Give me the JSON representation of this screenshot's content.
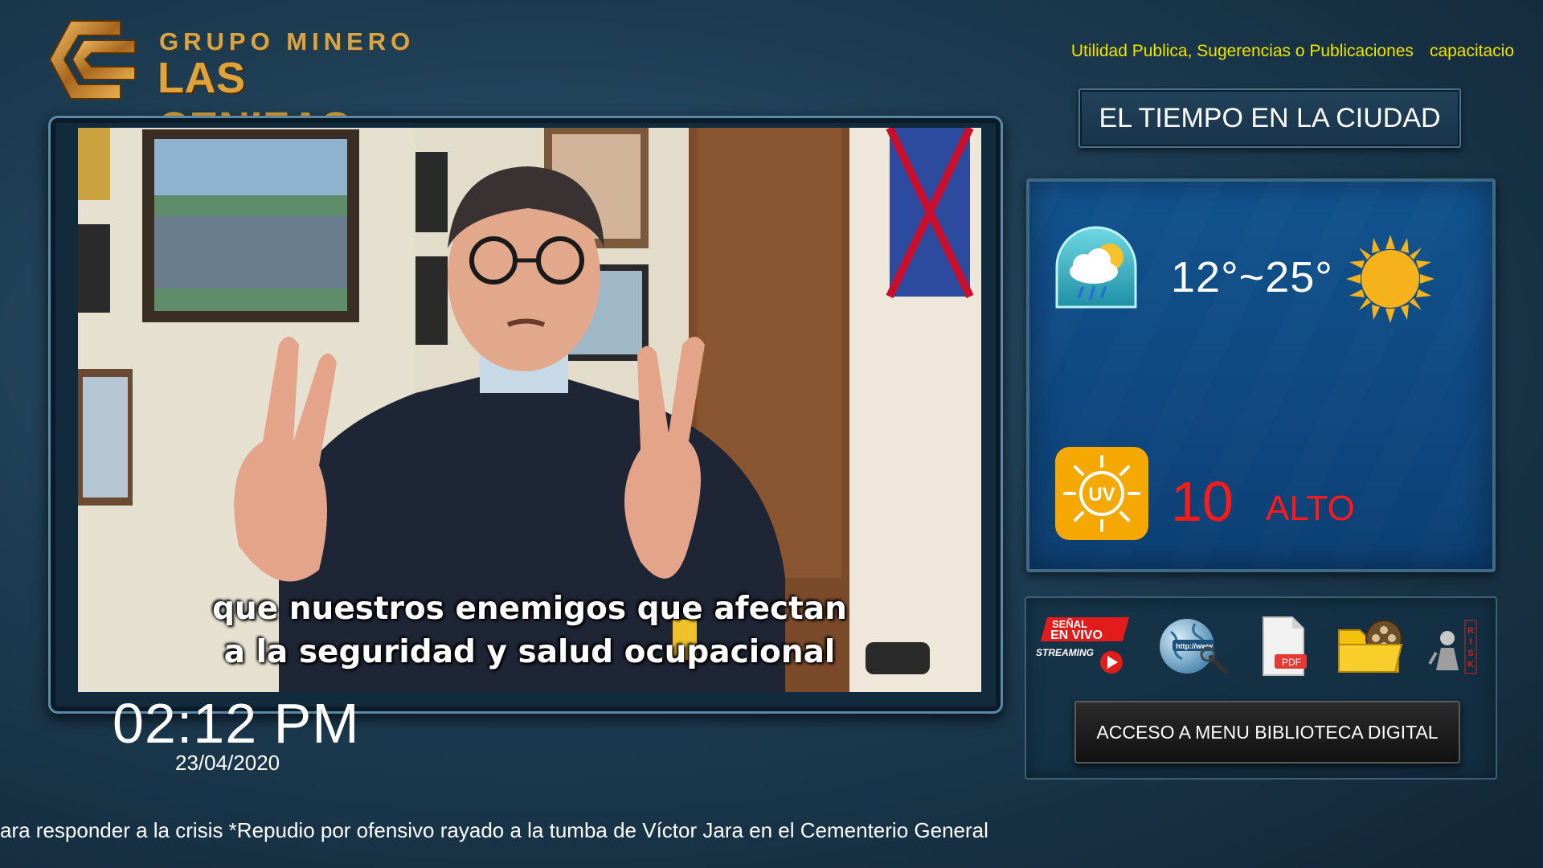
{
  "logo": {
    "line1": "GRUPO MINERO",
    "line2": "LAS CENIZAS"
  },
  "top_links": [
    {
      "label": "Utilidad Publica, Sugerencias o Publicaciones"
    },
    {
      "label": "capacitacio"
    }
  ],
  "weather": {
    "title": "EL TIEMPO EN LA CIUDAD",
    "temperature_range": "12°~25°",
    "condition_icon": "rain-cloud-sun-icon",
    "sun_icon": "sun-icon",
    "uv_badge_text": "UV",
    "uv_value": "10",
    "uv_level": "ALTO",
    "colors": {
      "uv_text": "#ff1a1a",
      "uv_badge": "#f5a800",
      "sun": "#f6b21a"
    }
  },
  "tools": {
    "items": [
      {
        "name": "live-streaming",
        "line1": "SEÑAL",
        "line2": "EN VIVO",
        "line3": "STREAMING"
      },
      {
        "name": "web-browser",
        "label": "http://www"
      },
      {
        "name": "pdf-document",
        "label": "PDF"
      },
      {
        "name": "video-folder"
      },
      {
        "name": "risk",
        "label": "RISK"
      }
    ],
    "library_button": "ACCESO A MENU BIBLIOTECA DIGITAL"
  },
  "video": {
    "subtitle": "que nuestros enemigos que afectan\na la seguridad y salud ocupacional"
  },
  "clock": {
    "time": "02:12 PM",
    "date": "23/04/2020"
  },
  "ticker": {
    "text": "ara responder a la crisis  *Repudio por ofensivo rayado a la tumba de Víctor Jara en el Cementerio General"
  }
}
